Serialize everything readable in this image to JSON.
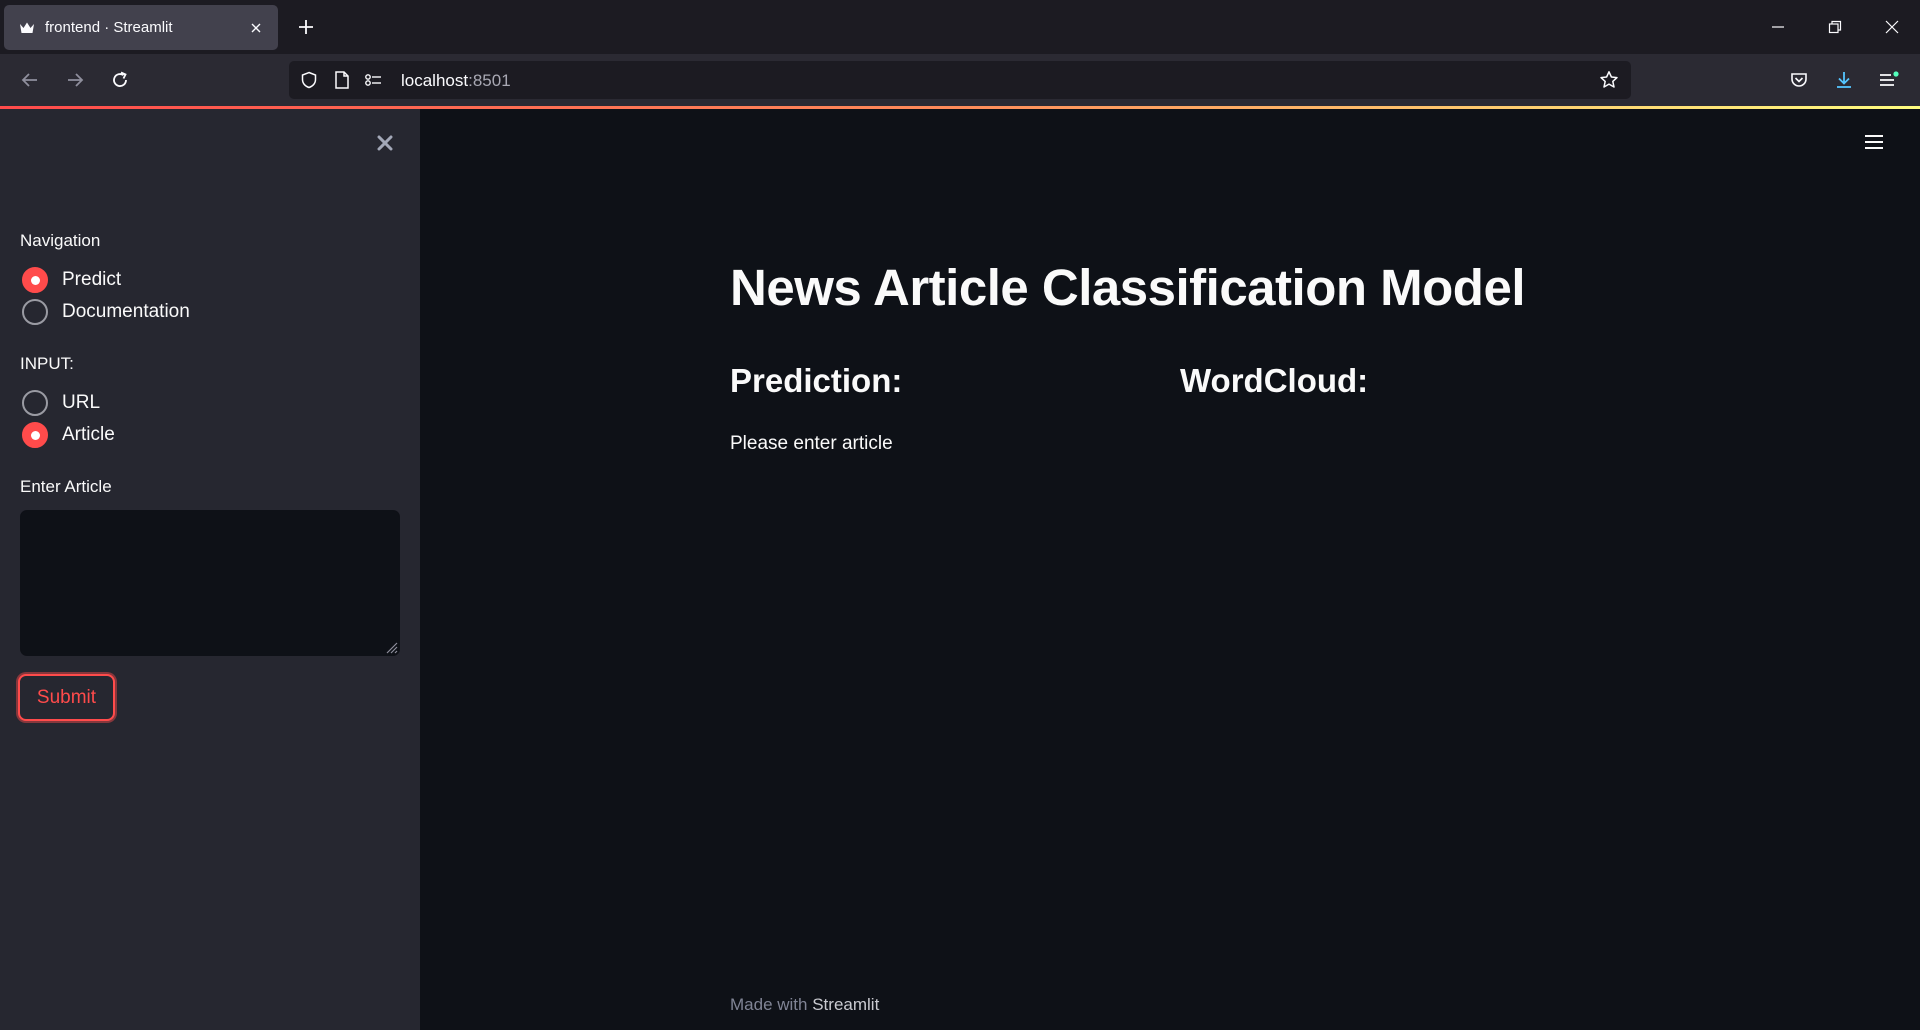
{
  "browser": {
    "tab_title": "frontend · Streamlit",
    "url_host": "localhost",
    "url_port": ":8501"
  },
  "sidebar": {
    "navigation_label": "Navigation",
    "navigation_options": [
      {
        "label": "Predict",
        "checked": true
      },
      {
        "label": "Documentation",
        "checked": false
      }
    ],
    "input_label": "INPUT:",
    "input_options": [
      {
        "label": "URL",
        "checked": false
      },
      {
        "label": "Article",
        "checked": true
      }
    ],
    "article_label": "Enter Article",
    "article_value": "",
    "submit_label": "Submit"
  },
  "main": {
    "title": "News Article Classification Model",
    "prediction_heading": "Prediction:",
    "wordcloud_heading": "WordCloud:",
    "prediction_message": "Please enter article"
  },
  "footer": {
    "made_with": "Made with",
    "brand": "Streamlit"
  },
  "colors": {
    "accent": "#ff4b4b",
    "background": "#0e1117",
    "sidebar": "#262730"
  }
}
